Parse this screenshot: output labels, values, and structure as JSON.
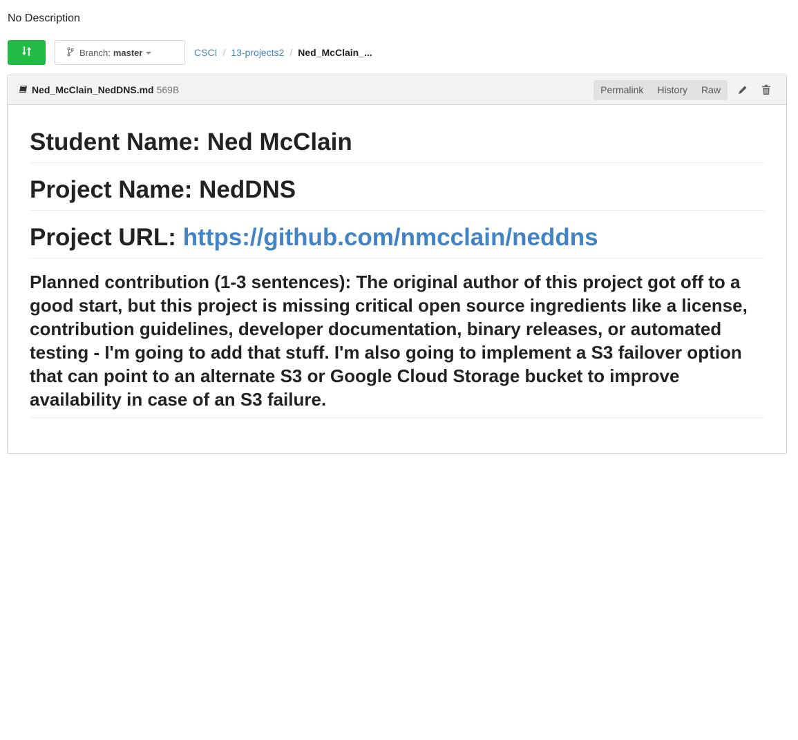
{
  "repo": {
    "description": "No Description"
  },
  "toolbar": {
    "compare_icon": "compare-arrows-icon",
    "branch_prefix": "Branch:",
    "branch_name": "master"
  },
  "breadcrumb": {
    "items": [
      "CSCI",
      "13-projects2"
    ],
    "current": "Ned_McClain_..."
  },
  "file": {
    "icon": "book-icon",
    "name": "Ned_McClain_NedDNS.md",
    "size": "569B",
    "actions": {
      "permalink": "Permalink",
      "history": "History",
      "raw": "Raw"
    },
    "edit_icon": "pencil-icon",
    "delete_icon": "trash-icon"
  },
  "content": {
    "student_heading": "Student Name: Ned McClain",
    "project_heading": "Project Name: NedDNS",
    "url_label": "Project URL: ",
    "url_link": "https://github.com/nmcclain/neddns",
    "contribution": "Planned contribution (1-3 sentences): The original author of this project got off to a good start, but this project is missing critical open source ingredients like a license, contribution guidelines, developer documentation, binary releases, or automated testing - I'm going to add that stuff. I'm also going to implement a S3 failover option that can point to an alternate S3 or Google Cloud Storage bucket to improve availability in case of an S3 failure."
  },
  "colors": {
    "green": "#21ba45",
    "link": "#4183c4",
    "header_bg": "#f3f3f3",
    "actions_bg": "#e0e1e2"
  }
}
